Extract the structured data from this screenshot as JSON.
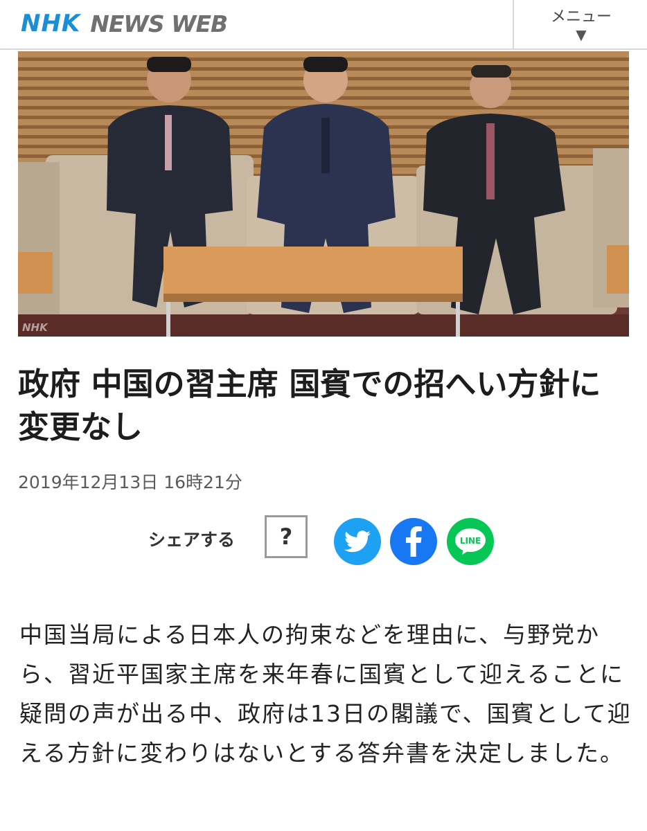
{
  "header": {
    "logo_nhk": "NHK",
    "logo_newsweb": "NEWS WEB",
    "menu_label": "メニュー",
    "menu_chevron": "▼"
  },
  "hero": {
    "watermark": "NHK"
  },
  "article": {
    "title": "政府 中国の習主席 国賓での招へい方針に変更なし",
    "timestamp": "2019年12月13日 16時21分",
    "body": "中国当局による日本人の拘束などを理由に、与野党から、習近平国家主席を来年春に国賓として迎えることに疑問の声が出る中、政府は13日の閣議で、国賓として迎える方針に変わりはないとする答弁書を決定しました。"
  },
  "share": {
    "label": "シェアする",
    "help": "?",
    "line_text": "LINE",
    "icons": [
      "twitter-icon",
      "facebook-icon",
      "line-icon"
    ]
  },
  "colors": {
    "nhk_blue": "#1a8fd8",
    "twitter": "#1da1f2",
    "facebook": "#1877f2",
    "line": "#06c755"
  }
}
